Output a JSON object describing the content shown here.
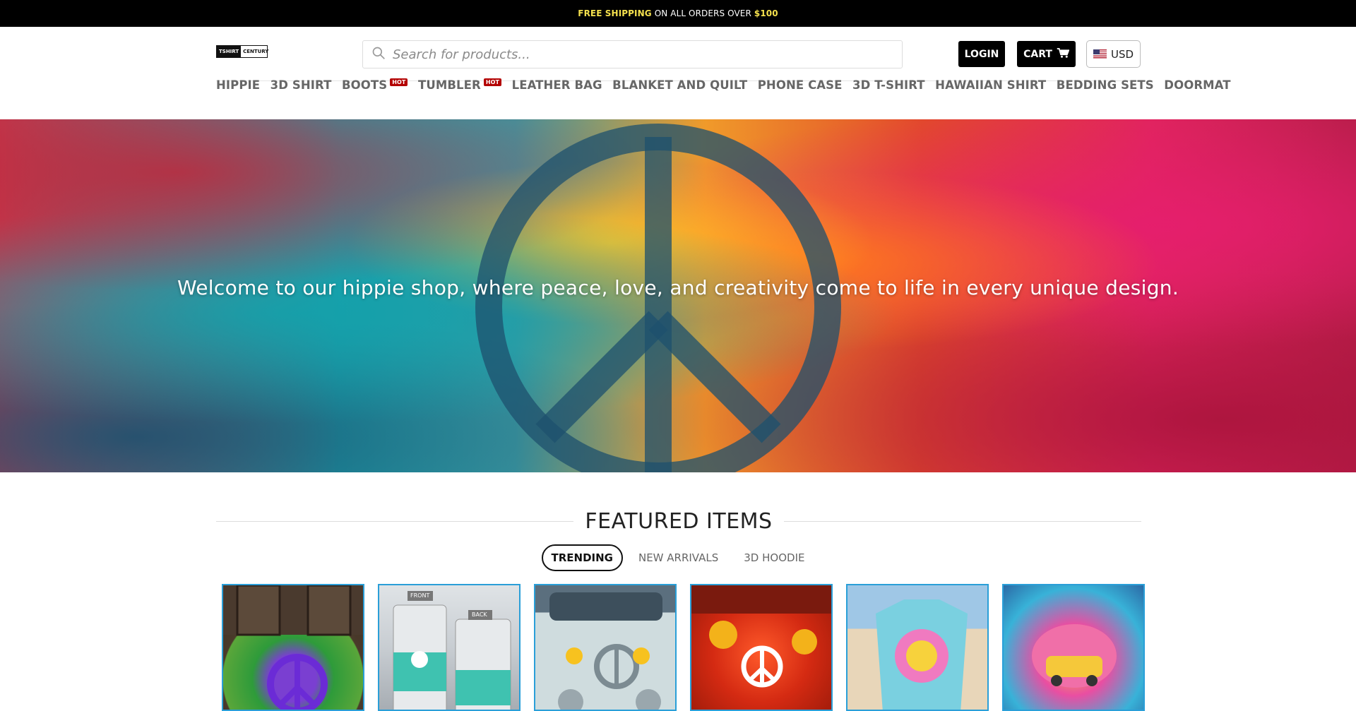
{
  "topbar": {
    "free_shipping": "FREE SHIPPING",
    "middle": "ON ALL ORDERS OVER",
    "amount": "$100"
  },
  "header": {
    "logo_left": "TSHIRT",
    "logo_right": "CENTURY",
    "search_placeholder": "Search for products...",
    "login_label": "LOGIN",
    "cart_label": "CART",
    "currency_label": "USD"
  },
  "nav": {
    "items": [
      {
        "label": "HIPPIE"
      },
      {
        "label": "3D SHIRT"
      },
      {
        "label": "BOOTS",
        "badge": "HOT"
      },
      {
        "label": "TUMBLER",
        "badge": "HOT"
      },
      {
        "label": "LEATHER BAG"
      },
      {
        "label": "BLANKET AND QUILT"
      },
      {
        "label": "PHONE CASE"
      },
      {
        "label": "3D T-SHIRT"
      },
      {
        "label": "HAWAIIAN SHIRT"
      },
      {
        "label": "BEDDING SETS"
      },
      {
        "label": "DOORMAT"
      }
    ]
  },
  "hero": {
    "text": "Welcome to our hippie shop, where peace, love, and creativity come to life in every unique design."
  },
  "featured": {
    "title": "FEATURED ITEMS",
    "tabs": [
      "TRENDING",
      "NEW ARRIVALS",
      "3D HOODIE"
    ]
  },
  "products": {
    "tumbler_front": "FRONT",
    "tumbler_back": "BACK"
  },
  "colors": {
    "accent_border": "#2a9fd8",
    "hot_badge": "#b30000",
    "topbar_highlight": "#f4e04d"
  }
}
